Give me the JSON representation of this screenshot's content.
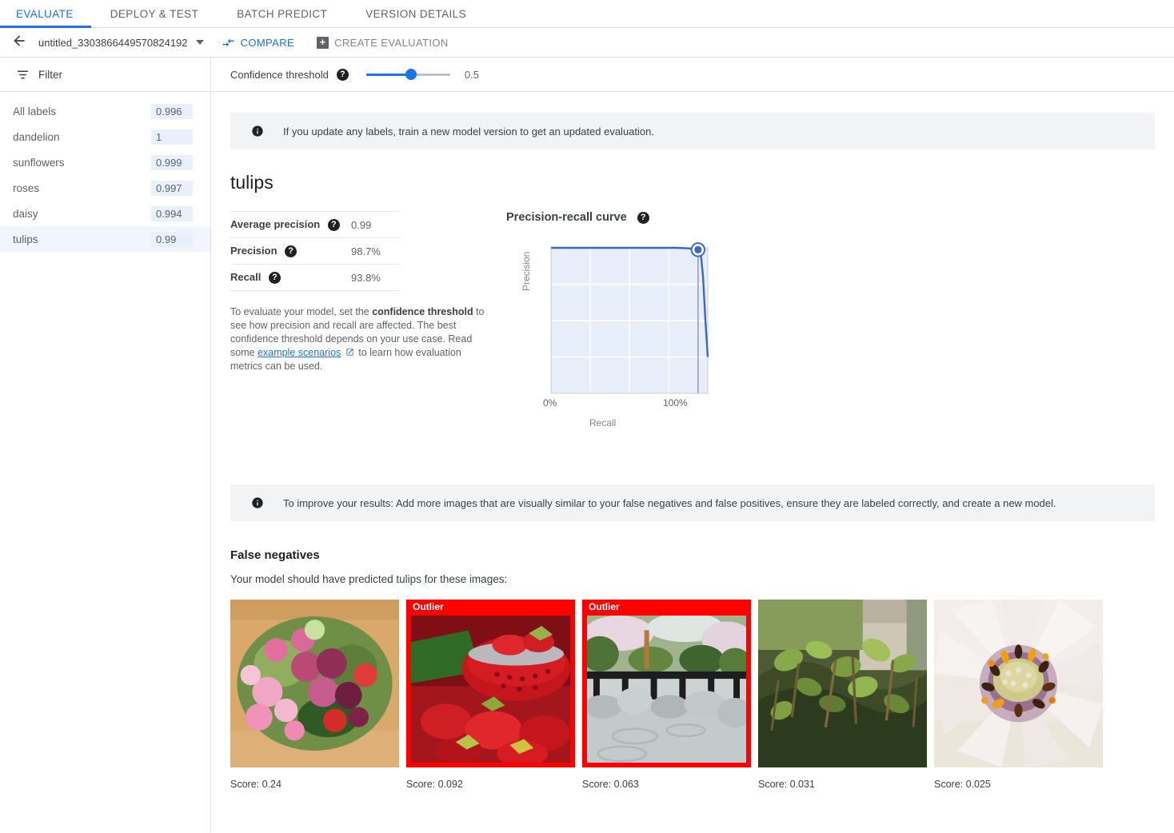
{
  "tabs": [
    {
      "label": "EVALUATE",
      "active": true
    },
    {
      "label": "DEPLOY & TEST",
      "active": false
    },
    {
      "label": "BATCH PREDICT",
      "active": false
    },
    {
      "label": "VERSION DETAILS",
      "active": false
    }
  ],
  "actionbar": {
    "back_icon": "arrow-back-icon",
    "model_name": "untitled_3303866449570824192",
    "compare_label": "COMPARE",
    "create_evaluation_label": "CREATE EVALUATION"
  },
  "sidebar": {
    "filter_label": "Filter",
    "labels": [
      {
        "name": "All labels",
        "score": "0.996",
        "selected": false
      },
      {
        "name": "dandelion",
        "score": "1",
        "selected": false
      },
      {
        "name": "sunflowers",
        "score": "0.999",
        "selected": false
      },
      {
        "name": "roses",
        "score": "0.997",
        "selected": false
      },
      {
        "name": "daisy",
        "score": "0.994",
        "selected": false
      },
      {
        "name": "tulips",
        "score": "0.99",
        "selected": true
      }
    ]
  },
  "threshold": {
    "label": "Confidence threshold",
    "value": "0.5",
    "help_icon": "help-icon"
  },
  "banner_top": {
    "icon": "info-icon",
    "text": "If you update any labels, train a new model version to get an updated evaluation."
  },
  "evaluation": {
    "title": "tulips",
    "metrics": [
      {
        "key": "Average precision",
        "value": "0.99"
      },
      {
        "key": "Precision",
        "value": "98.7%"
      },
      {
        "key": "Recall",
        "value": "93.8%"
      }
    ],
    "note_part1": "To evaluate your model, set the ",
    "note_bold": "confidence threshold",
    "note_part2": " to see how precision and recall are affected. The best confidence threshold depends on your use case. Read some ",
    "note_link": "example scenarios",
    "note_part3": " to learn how evaluation metrics can be used."
  },
  "chart_data": {
    "type": "line",
    "title": "Precision-recall curve",
    "xlabel": "Recall",
    "ylabel": "Precision",
    "xticks": [
      "0%",
      "100%"
    ],
    "xlim": [
      0,
      100
    ],
    "ylim": [
      0,
      100
    ],
    "grid": true,
    "legend": null,
    "series": [
      {
        "name": "Precision-recall",
        "x": [
          0,
          10,
          20,
          30,
          40,
          50,
          60,
          70,
          80,
          88,
          93.8,
          95.5,
          97,
          98.5,
          100
        ],
        "y": [
          100,
          100,
          100,
          100,
          100,
          100,
          100,
          100,
          100,
          99.6,
          98.7,
          96.5,
          80,
          50,
          25
        ]
      }
    ],
    "marker": {
      "x": 93.8,
      "y": 98.7,
      "label": "current threshold"
    },
    "threshold_line_x": 93.8,
    "fill_color": "#e8eef9",
    "line_color": "#3b68c4"
  },
  "banner_bottom": {
    "icon": "info-icon",
    "text": "To improve your results: Add more images that are visually similar to your false negatives and false positives, ensure they are labeled correctly, and create a new model."
  },
  "false_negatives": {
    "title": "False negatives",
    "subtitle": "Your model should have predicted tulips for these images:",
    "outlier_tag": "Outlier",
    "items": [
      {
        "score_text": "Score: 0.24",
        "outlier": false,
        "alt": "pink-and-purple-tulip-bouquet"
      },
      {
        "score_text": "Score: 0.092",
        "outlier": true,
        "alt": "strawberries-in-red-colander"
      },
      {
        "score_text": "Score: 0.063",
        "outlier": true,
        "alt": "japanese-garden-stone-pond"
      },
      {
        "score_text": "Score: 0.031",
        "outlier": false,
        "alt": "green-weeds-on-mossy-rock"
      },
      {
        "score_text": "Score: 0.025",
        "outlier": false,
        "alt": "white-daisy-flower-closeup"
      }
    ]
  },
  "colors": {
    "accent": "#1a73e8",
    "outlier": "#ff0000",
    "selected_row": "#f1f5fd",
    "chip": "#eaf0fb",
    "banner_bg": "#f1f3f4"
  }
}
